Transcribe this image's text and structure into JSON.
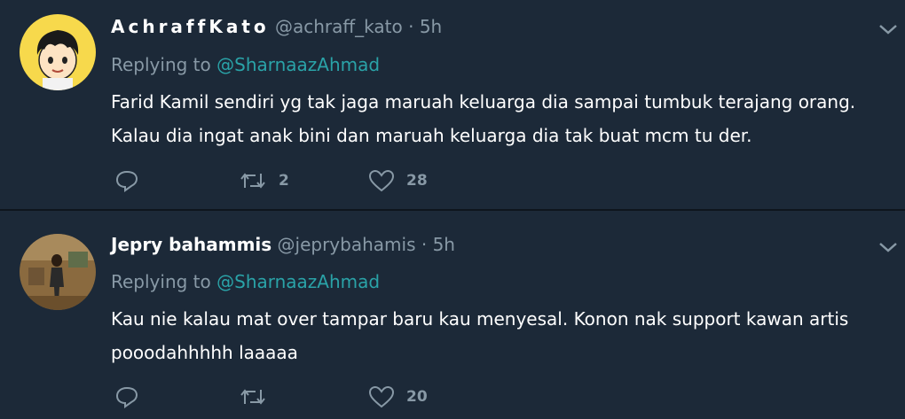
{
  "tweets": [
    {
      "display_name": "AchraffKato",
      "handle": "@achraff_kato",
      "separator": "·",
      "time": "5h",
      "replying_prefix": "Replying to",
      "replying_to": "@SharnaazAhmad",
      "text": "Farid Kamil sendiri yg tak jaga maruah keluarga dia sampai tumbuk terajang orang. Kalau dia ingat anak bini dan maruah keluarga dia tak buat mcm tu der.",
      "retweets": "2",
      "likes": "28",
      "avatar_icon": "cartoon-boy-avatar"
    },
    {
      "display_name": "Jepry bahammis",
      "handle": "@jeprybahamis",
      "separator": "·",
      "time": "5h",
      "replying_prefix": "Replying to",
      "replying_to": "@SharnaazAhmad",
      "text": "Kau nie kalau mat over tampar baru kau menyesal. Konon nak support kawan artis pooodahhhhh laaaaa",
      "retweets": "",
      "likes": "20",
      "avatar_icon": "person-photo-avatar"
    }
  ],
  "colors": {
    "background": "#1c2938",
    "secondary_text": "#8899a6",
    "link": "#2aa3a8",
    "divider": "#0e151d"
  },
  "icons": [
    "reply-icon",
    "retweet-icon",
    "like-icon",
    "chevron-down-icon"
  ]
}
